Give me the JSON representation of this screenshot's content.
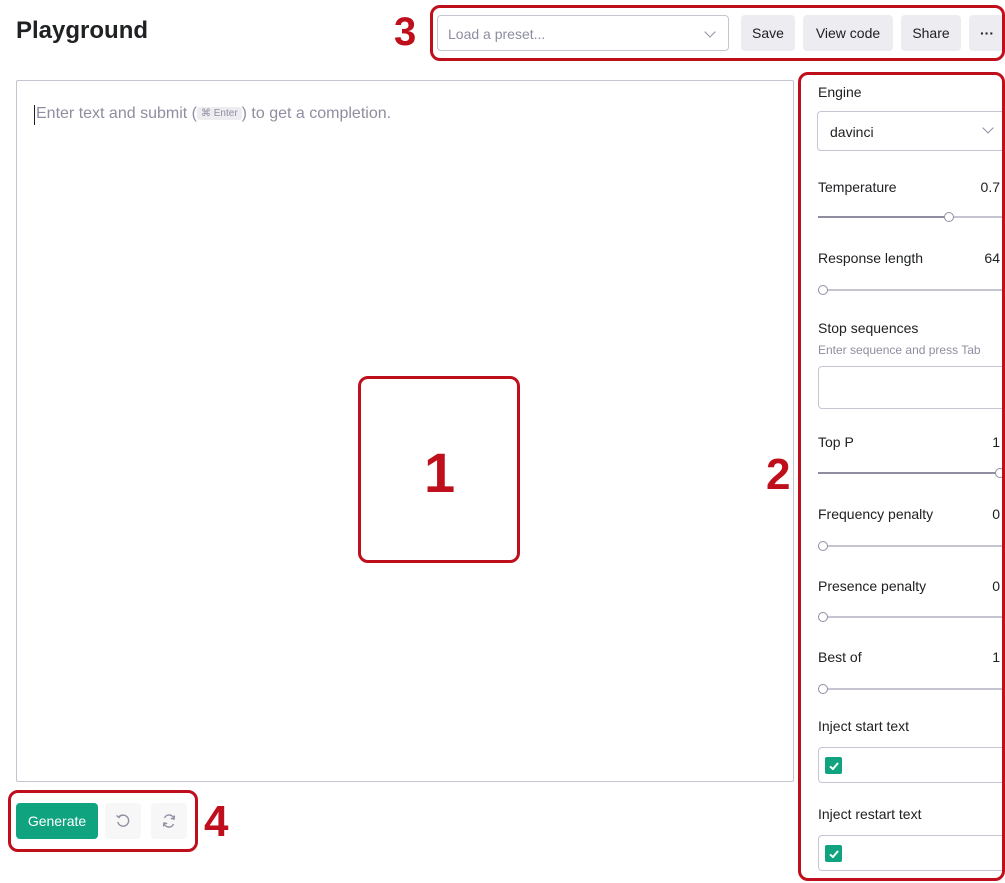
{
  "header": {
    "title": "Playground"
  },
  "toolbar": {
    "preset_placeholder": "Load a preset...",
    "save_label": "Save",
    "view_code_label": "View code",
    "share_label": "Share",
    "more_label": "···"
  },
  "editor": {
    "hint_before": "Enter text and submit (",
    "kbd_symbol": "⌘",
    "kbd_key": "Enter",
    "hint_after": ") to get a completion."
  },
  "actions": {
    "generate_label": "Generate",
    "undo_icon": "undo-icon",
    "regenerate_icon": "regenerate-icon"
  },
  "settings": {
    "engine": {
      "label": "Engine",
      "value": "davinci"
    },
    "temperature": {
      "label": "Temperature",
      "value": "0.7",
      "fraction": 0.7
    },
    "response_length": {
      "label": "Response length",
      "value": "64",
      "fraction": 0.0
    },
    "stop_sequences": {
      "label": "Stop sequences",
      "hint": "Enter sequence and press Tab"
    },
    "top_p": {
      "label": "Top P",
      "value": "1",
      "fraction": 1.0
    },
    "frequency_penalty": {
      "label": "Frequency penalty",
      "value": "0",
      "fraction": 0.0
    },
    "presence_penalty": {
      "label": "Presence penalty",
      "value": "0",
      "fraction": 0.0
    },
    "best_of": {
      "label": "Best of",
      "value": "1",
      "fraction": 0.0
    },
    "inject_start": {
      "label": "Inject start text",
      "checked": true
    },
    "inject_restart": {
      "label": "Inject restart text",
      "checked": true
    }
  },
  "annotations": {
    "n1": "1",
    "n2": "2",
    "n3": "3",
    "n4": "4",
    "color": "#c00f1c"
  },
  "colors": {
    "accent": "#10a37f",
    "border": "#c5c5d2",
    "button_bg": "#ececf1"
  }
}
